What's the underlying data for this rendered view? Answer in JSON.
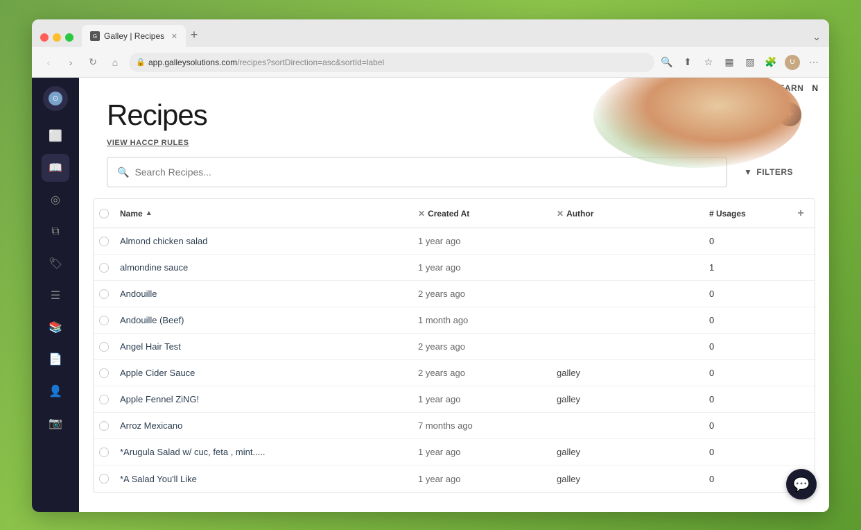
{
  "browser": {
    "tab_title": "Galley | Recipes",
    "url_domain": "app.galleysolutions.com",
    "url_path": "/recipes?sortDirection=asc&sortId=label",
    "new_tab_label": "+",
    "learn_label": "LEARN",
    "n_label": "N"
  },
  "sidebar": {
    "items": [
      {
        "id": "logo",
        "icon": "⊙",
        "label": "logo"
      },
      {
        "id": "page",
        "icon": "⬜",
        "label": "page"
      },
      {
        "id": "book",
        "icon": "📖",
        "label": "recipes",
        "active": true
      },
      {
        "id": "signal",
        "icon": "◎",
        "label": "signals"
      },
      {
        "id": "layers",
        "icon": "⧉",
        "label": "layers"
      },
      {
        "id": "tag",
        "icon": "🏷",
        "label": "tags"
      },
      {
        "id": "list",
        "icon": "☰",
        "label": "list"
      },
      {
        "id": "book2",
        "icon": "📚",
        "label": "book"
      },
      {
        "id": "doc",
        "icon": "📄",
        "label": "document"
      },
      {
        "id": "person",
        "icon": "👤",
        "label": "person"
      },
      {
        "id": "camera",
        "icon": "📷",
        "label": "camera"
      }
    ]
  },
  "page": {
    "title": "Recipes",
    "add_button_label": "+",
    "view_haccp_label": "VIEW HACCP RULES",
    "search_placeholder": "Search Recipes...",
    "filters_label": "FILTERS",
    "table": {
      "columns": [
        {
          "id": "check",
          "label": ""
        },
        {
          "id": "name",
          "label": "Name",
          "sortable": true,
          "sort_dir": "asc"
        },
        {
          "id": "created_at",
          "label": "Created At",
          "removable": true
        },
        {
          "id": "author",
          "label": "Author",
          "removable": true
        },
        {
          "id": "usages",
          "label": "# Usages"
        },
        {
          "id": "add",
          "label": "+"
        }
      ],
      "rows": [
        {
          "name": "Almond chicken salad",
          "created_at": "1 year ago",
          "author": "",
          "usages": "0"
        },
        {
          "name": "almondine sauce",
          "created_at": "1 year ago",
          "author": "",
          "usages": "1"
        },
        {
          "name": "Andouille",
          "created_at": "2 years ago",
          "author": "",
          "usages": "0"
        },
        {
          "name": "Andouille (Beef)",
          "created_at": "1 month ago",
          "author": "",
          "usages": "0"
        },
        {
          "name": "Angel Hair Test",
          "created_at": "2 years ago",
          "author": "",
          "usages": "0"
        },
        {
          "name": "Apple Cider Sauce",
          "created_at": "2 years ago",
          "author": "galley",
          "usages": "0"
        },
        {
          "name": "Apple Fennel ZiNG!",
          "created_at": "1 year ago",
          "author": "galley",
          "usages": "0"
        },
        {
          "name": "Arroz Mexicano",
          "created_at": "7 months ago",
          "author": "",
          "usages": "0"
        },
        {
          "name": "*Arugula Salad w/ cuc, feta , mint.....",
          "created_at": "1 year ago",
          "author": "galley",
          "usages": "0"
        },
        {
          "name": "*A Salad You'll Like",
          "created_at": "1 year ago",
          "author": "galley",
          "usages": "0"
        }
      ]
    }
  }
}
